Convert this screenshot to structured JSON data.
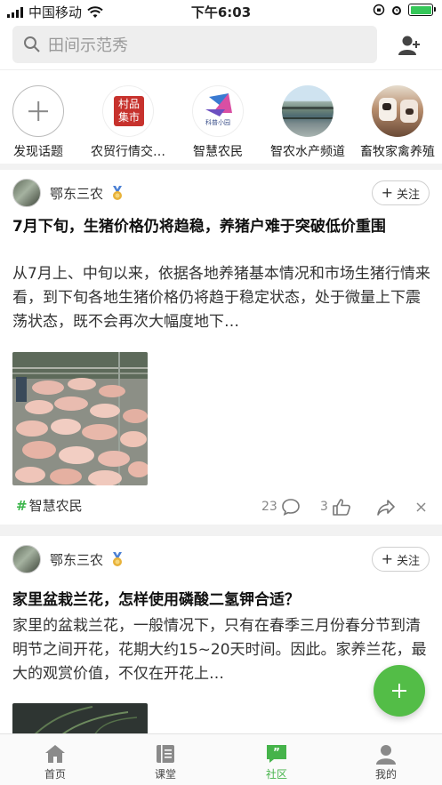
{
  "status_bar": {
    "carrier": "中国移动",
    "time": "下午6:03",
    "colors": {
      "battery": "#35c759"
    }
  },
  "search": {
    "placeholder": "田间示范秀",
    "icon": "search-icon"
  },
  "header": {
    "add_friend_icon": "add-user-icon"
  },
  "topics": [
    {
      "label": "发现话题",
      "icon": "plus-icon"
    },
    {
      "label": "农贸行情交…",
      "icon": "market-logo"
    },
    {
      "label": "智慧农民",
      "icon": "smart-farmer-logo"
    },
    {
      "label": "智农水产频道",
      "icon": "aquaculture-photo"
    },
    {
      "label": "畜牧家禽养殖",
      "icon": "livestock-photo"
    }
  ],
  "topic_logo_text": {
    "market": "村品集市",
    "smart": "科普小园"
  },
  "posts": [
    {
      "author": "鄂东三农",
      "follow_label": "关注",
      "title": "7月下旬，生猪价格仍将趋稳，养猪户难于突破低价重围",
      "body": "从7月上、中旬以来，依据各地养猪基本情况和市场生猪行情来看，到下旬各地生猪价格仍将趋于稳定状态，处于微量上下震荡状态，既不会再次大幅度地下…",
      "image": "pig-farm-photo",
      "tag": "智慧农民",
      "comments": "23",
      "likes": "3"
    },
    {
      "author": "鄂东三农",
      "follow_label": "关注",
      "title": "家里盆栽兰花，怎样使用磷酸二氢钾合适？",
      "body": "家里的盆栽兰花，一般情况下，只有在春季三月份春分节到清明节之间开花，花期大约15~20天时间。因此。家养兰花，最大的观赏价值，不仅在开花上…",
      "image": "orchid-photo"
    }
  ],
  "fab": {
    "icon": "plus-icon",
    "color": "#53bd47"
  },
  "tabbar": {
    "items": [
      {
        "label": "首页",
        "icon": "home-icon"
      },
      {
        "label": "课堂",
        "icon": "book-icon"
      },
      {
        "label": "社区",
        "icon": "chat-bubble-icon",
        "active": true
      },
      {
        "label": "我的",
        "icon": "user-icon"
      }
    ],
    "active_color": "#45b34a"
  }
}
